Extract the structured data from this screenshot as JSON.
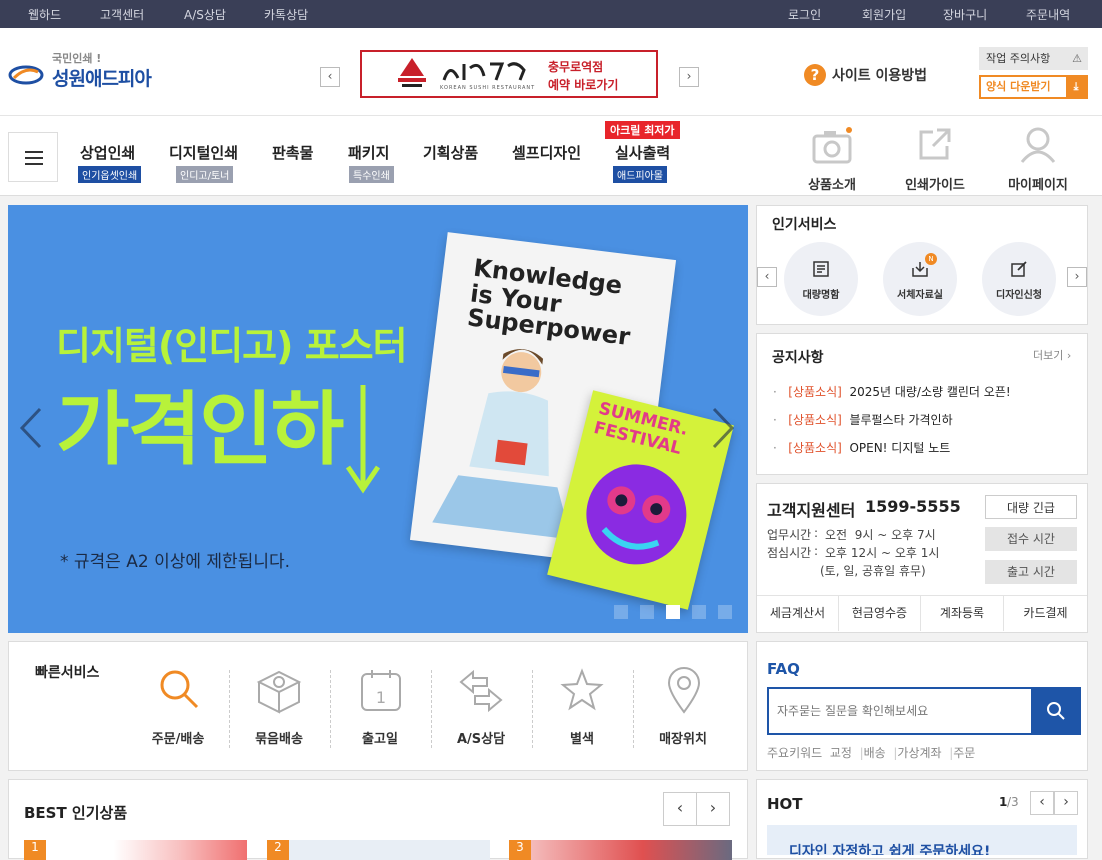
{
  "topbar": {
    "links_left": [
      "웹하드",
      "고객센터",
      "A/S상담",
      "카톡상담"
    ],
    "links_right": [
      "로그인",
      "회원가입",
      "장바구니",
      "주문내역"
    ]
  },
  "header": {
    "logo_small": "국민인쇄 !",
    "logo_main": "성원애드피아",
    "banner_line1": "충무로역점",
    "banner_line2": "예약 바로가기",
    "banner_sub": "KOREAN SUSHI RESTAURANT",
    "help_label": "사이트 이용방법",
    "notice_btn": "작업 주의사항",
    "download_btn": "양식 다운받기"
  },
  "nav": {
    "items": [
      {
        "label": "상업인쇄",
        "sub": "인기옵셋인쇄"
      },
      {
        "label": "디지털인쇄",
        "sub": "인디고/토너"
      },
      {
        "label": "판촉물",
        "sub": ""
      },
      {
        "label": "패키지",
        "sub": "특수인쇄"
      },
      {
        "label": "기획상품",
        "sub": ""
      },
      {
        "label": "셀프디자인",
        "sub": ""
      },
      {
        "label": "실사출력",
        "sub": "애드피아몰"
      }
    ],
    "badge": "아크릴 최저가",
    "right_links": [
      "상품소개",
      "인쇄가이드",
      "마이페이지"
    ]
  },
  "hero": {
    "subtitle": "디지털(인디고) 포스터",
    "title": "가격인하",
    "footnote": "* 규격은 A2 이상에 제한됩니다.",
    "poster_text": [
      "Knowledge",
      "is Your",
      "Superpower"
    ],
    "festival_text": [
      "SUMMER.",
      "FESTIVAL"
    ],
    "bg_color": "#4a90e2",
    "accent_color": "#b8f23a",
    "active_slide": 3,
    "slide_count": 5
  },
  "popular": {
    "title": "인기서비스",
    "items": [
      "대량명함",
      "서체자료실",
      "디자인신청"
    ],
    "new_badge": "N"
  },
  "notice": {
    "title": "공지사항",
    "more": "더보기",
    "items": [
      {
        "tag": "[상품소식]",
        "text": "2025년 대량/소량 캘린더 오픈!"
      },
      {
        "tag": "[상품소식]",
        "text": "블루펄스타 가격인하"
      },
      {
        "tag": "[상품소식]",
        "text": "OPEN! 디지털 노트"
      }
    ]
  },
  "cs": {
    "title": "고객지원센터",
    "phone": "1599-5555",
    "hours_label": "업무시간",
    "hours": "오전  9시 ~ 오후 7시",
    "lunch_label": "점심시간",
    "lunch": "오후 12시 ~ 오후 1시",
    "closed": "(토, 일, 공휴일 휴무)",
    "sep": ":",
    "buttons": [
      "대량 긴급",
      "접수 시간",
      "출고 시간"
    ],
    "tabs": [
      "세금계산서",
      "현금영수증",
      "계좌등록",
      "카드결제"
    ]
  },
  "quick": {
    "title": "빠른서비스",
    "items": [
      "주문/배송",
      "묶음배송",
      "출고일",
      "A/S상담",
      "별색",
      "매장위치"
    ],
    "calendar_digit": "1"
  },
  "faq": {
    "title": "FAQ",
    "placeholder": "자주묻는 질문을 확인해보세요",
    "keywords_label": "주요키워드",
    "keywords": [
      "교정",
      "배송",
      "가상계좌",
      "주문"
    ]
  },
  "best": {
    "title": "BEST 인기상품",
    "ranks": [
      "1",
      "2",
      "3"
    ]
  },
  "hot": {
    "title": "HOT",
    "page_current": "1",
    "page_total": "/3",
    "preview_text": "디자인 자정하고 쉽게 주문하세요!"
  },
  "colors": {
    "topbar": "#3a3f57",
    "brand_blue": "#1e4fa3",
    "accent_orange": "#f08a24",
    "notice_red": "#e0532d",
    "faq_blue": "#1e55a8"
  }
}
